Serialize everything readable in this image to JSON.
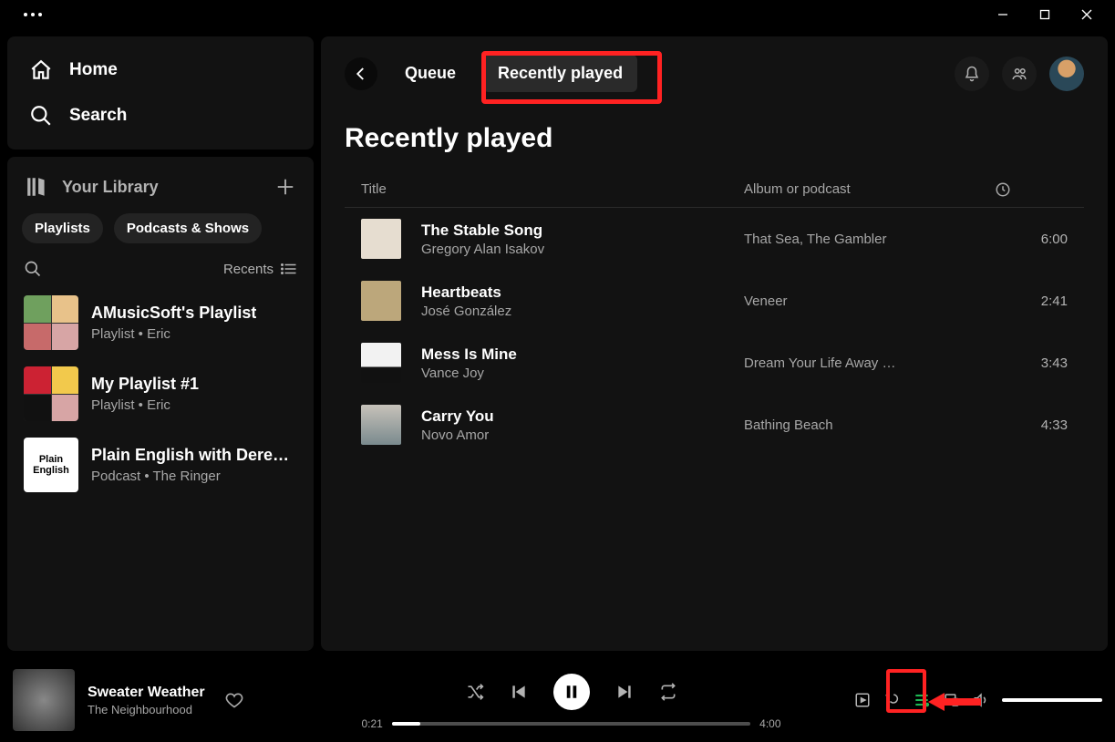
{
  "window": {
    "minimize": "Minimize",
    "maximize": "Restore",
    "close": "Close"
  },
  "sidebar": {
    "nav": {
      "home": "Home",
      "search": "Search"
    },
    "library": {
      "label": "Your Library",
      "chips": [
        "Playlists",
        "Podcasts & Shows"
      ],
      "sort": "Recents",
      "items": [
        {
          "name": "AMusicSoft's Playlist",
          "meta": "Playlist • Eric",
          "artKind": "grid"
        },
        {
          "name": "My Playlist #1",
          "meta": "Playlist • Eric",
          "artKind": "grid2"
        },
        {
          "name": "Plain English with Derek…",
          "meta": "Podcast • The Ringer",
          "artKind": "pod",
          "artText": "Plain English"
        }
      ]
    }
  },
  "main": {
    "tabs": {
      "queue": "Queue",
      "recent": "Recently played"
    },
    "heading": "Recently played",
    "columns": {
      "title": "Title",
      "album": "Album or podcast"
    },
    "tracks": [
      {
        "title": "The Stable Song",
        "artist": "Gregory Alan Isakov",
        "album": "That Sea, The Gambler",
        "duration": "6:00",
        "art": "a1"
      },
      {
        "title": "Heartbeats",
        "artist": "José González",
        "album": "Veneer",
        "duration": "2:41",
        "art": "a2"
      },
      {
        "title": "Mess Is Mine",
        "artist": "Vance Joy",
        "album": "Dream Your Life Away …",
        "duration": "3:43",
        "art": "a3"
      },
      {
        "title": "Carry You",
        "artist": "Novo Amor",
        "album": "Bathing Beach",
        "duration": "4:33",
        "art": "a4"
      }
    ]
  },
  "player": {
    "track": "Sweater Weather",
    "artist": "The Neighbourhood",
    "elapsed": "0:21",
    "total": "4:00"
  },
  "colors": {
    "accent": "#1db954",
    "highlight": "#f22"
  }
}
